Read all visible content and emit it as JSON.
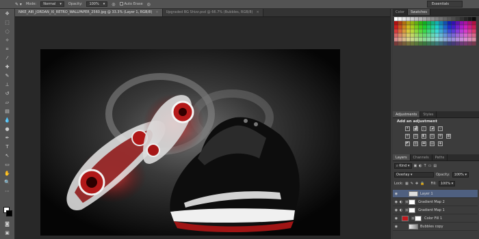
{
  "options": {
    "mode_label": "Mode:",
    "mode_value": "Normal",
    "opacity_label": "Opacity:",
    "opacity_value": "100%",
    "auto_erase": "Auto Erase",
    "workspace": "Essentials"
  },
  "tabs": [
    {
      "label": "NIKE_AIR_JORDAN_XI_RETRO_WALLPAPER_2560.jpg @ 33.3% (Layer 1, RGB/8)",
      "close": "×",
      "active": true
    },
    {
      "label": "Upgraded BG Shizz.psd @ 66.7% (Bubbles, RGB/8)",
      "close": "×",
      "active": false
    }
  ],
  "swatch_panel": {
    "tabs": [
      "Color",
      "Swatches"
    ]
  },
  "adjust_panel": {
    "tabs": [
      "Adjustments",
      "Styles"
    ],
    "title": "Add an adjustment"
  },
  "layers_panel": {
    "tabs": [
      "Layers",
      "Channels",
      "Paths"
    ],
    "filter": "Kind",
    "blend_mode": "Overlay",
    "opacity_label": "Opacity:",
    "opacity": "100%",
    "lock_label": "Lock:",
    "fill_label": "Fill:",
    "fill": "100%",
    "layers": [
      {
        "name": "Layer 1",
        "active": true
      },
      {
        "name": "Gradient Map 2",
        "active": false
      },
      {
        "name": "Gradient Map 1",
        "active": false
      },
      {
        "name": "Color Fill 1",
        "active": false
      },
      {
        "name": "Bubbles copy",
        "active": false
      }
    ]
  },
  "colors": {
    "accent": "#4f6080",
    "layer_red": "#c0181d"
  }
}
